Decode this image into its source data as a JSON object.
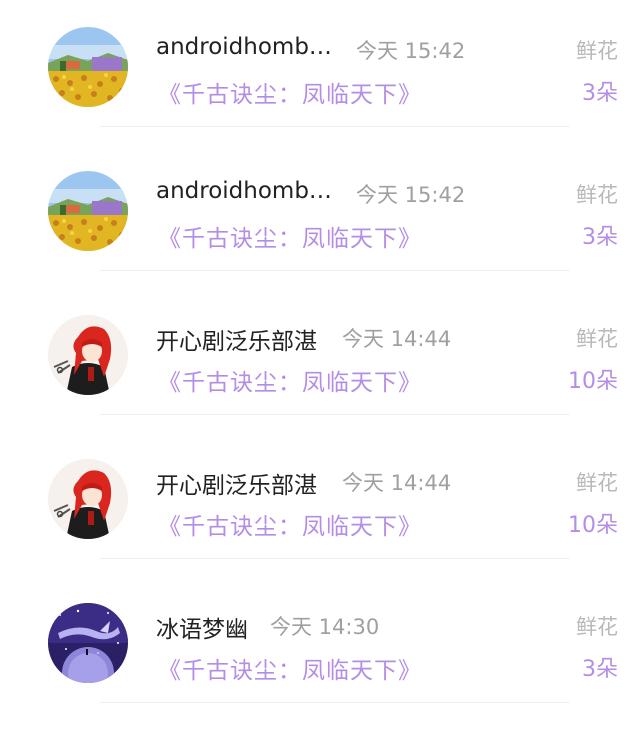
{
  "rows": [
    {
      "avatar": "sunflower-landscape-avatar",
      "user": "androidhomb…",
      "time": "今天 15:42",
      "book": "《千古诀尘：凤临天下》",
      "gift_label": "鲜花",
      "count": "3朵"
    },
    {
      "avatar": "sunflower-landscape-avatar",
      "user": "androidhomb…",
      "time": "今天 15:42",
      "book": "《千古诀尘：凤临天下》",
      "gift_label": "鲜花",
      "count": "3朵"
    },
    {
      "avatar": "red-hair-anime-avatar",
      "user": "开心剧泛乐部湛",
      "time": "今天 14:44",
      "book": "《千古诀尘：凤临天下》",
      "gift_label": "鲜花",
      "count": "10朵"
    },
    {
      "avatar": "red-hair-anime-avatar",
      "user": "开心剧泛乐部湛",
      "time": "今天 14:44",
      "book": "《千古诀尘：凤临天下》",
      "gift_label": "鲜花",
      "count": "10朵"
    },
    {
      "avatar": "purple-galaxy-avatar",
      "user": "冰语梦幽",
      "time": "今天 14:30",
      "book": "《千古诀尘：凤临天下》",
      "gift_label": "鲜花",
      "count": "3朵"
    }
  ],
  "colors": {
    "accent": "#b48ee6",
    "muted": "#a0a0a0",
    "text": "#222222"
  }
}
